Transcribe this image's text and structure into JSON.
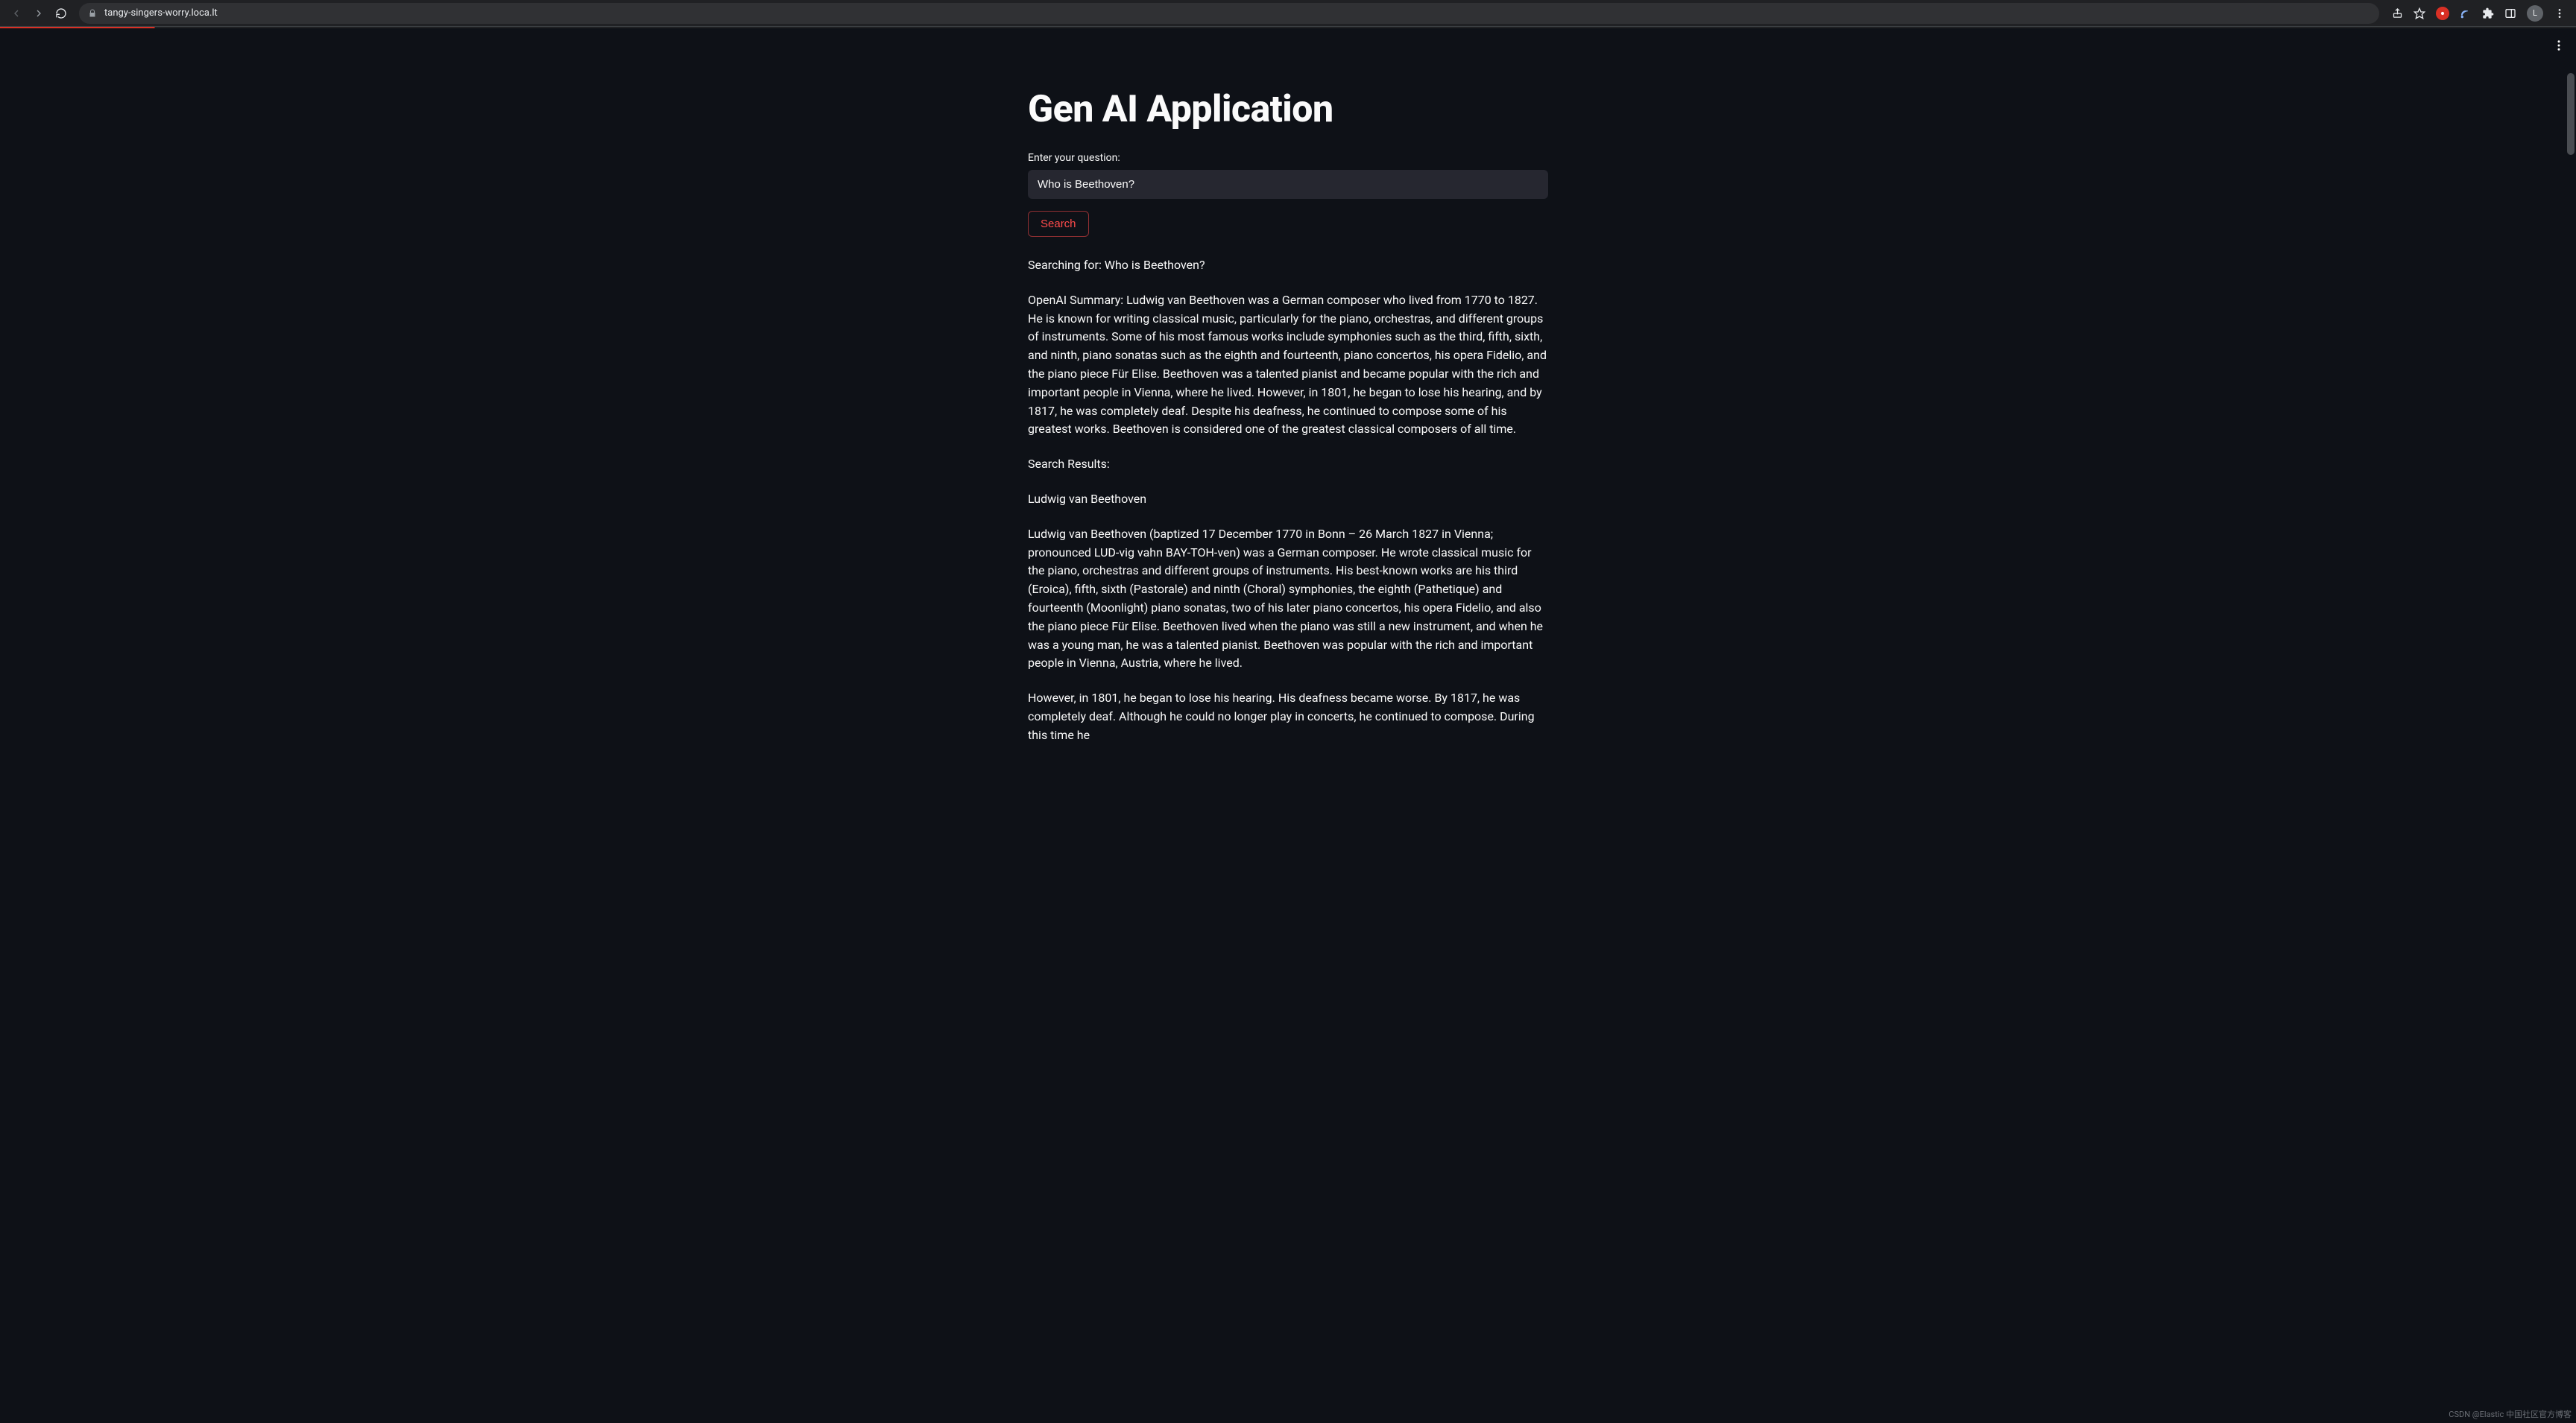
{
  "browser": {
    "url": "tangy-singers-worry.loca.lt",
    "avatar_letter": "L"
  },
  "page": {
    "title": "Gen AI Application",
    "input_label": "Enter your question:",
    "input_value": "Who is Beethoven?",
    "search_button": "Search",
    "searching_for": "Searching for: Who is Beethoven?",
    "summary": "OpenAI Summary: Ludwig van Beethoven was a German composer who lived from 1770 to 1827. He is known for writing classical music, particularly for the piano, orchestras, and different groups of instruments. Some of his most famous works include symphonies such as the third, fifth, sixth, and ninth, piano sonatas such as the eighth and fourteenth, piano concertos, his opera Fidelio, and the piano piece Für Elise. Beethoven was a talented pianist and became popular with the rich and important people in Vienna, where he lived. However, in 1801, he began to lose his hearing, and by 1817, he was completely deaf. Despite his deafness, he continued to compose some of his greatest works. Beethoven is considered one of the greatest classical composers of all time.",
    "results_heading": "Search Results:",
    "result_title": "Ludwig van Beethoven",
    "result_body_1": "Ludwig van Beethoven (baptized 17 December 1770 in Bonn – 26 March 1827 in Vienna; pronounced LUD-vig vahn BAY-TOH-ven) was a German composer. He wrote classical music for the piano, orchestras and different groups of instruments. His best-known works are his third (Eroica), fifth, sixth (Pastorale) and ninth (Choral) symphonies, the eighth (Pathetique) and fourteenth (Moonlight) piano sonatas, two of his later piano concertos, his opera Fidelio, and also the piano piece Für Elise. Beethoven lived when the piano was still a new instrument, and when he was a young man, he was a talented pianist. Beethoven was popular with the rich and important people in Vienna, Austria, where he lived.",
    "result_body_2": "However, in 1801, he began to lose his hearing. His deafness became worse. By 1817, he was completely deaf. Although he could no longer play in concerts, he continued to compose. During this time he"
  },
  "watermark": "CSDN @Elastic 中国社区官方博客"
}
